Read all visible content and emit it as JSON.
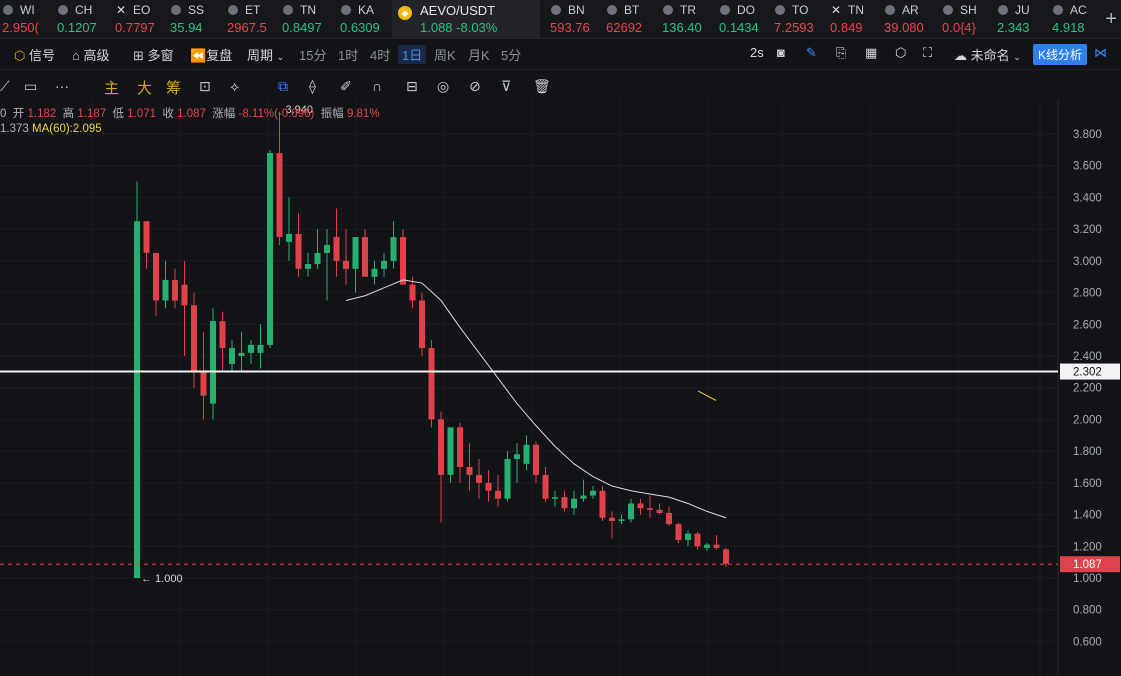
{
  "tickers": [
    {
      "icon": "coin-icon",
      "sym": "WI",
      "price": "2.950(",
      "dir": "dn",
      "left": 0
    },
    {
      "icon": "coin-icon",
      "sym": "CH",
      "price": "0.1207",
      "dir": "up",
      "left": 55
    },
    {
      "icon": "x-icon",
      "sym": "EO",
      "price": "0.7797",
      "dir": "dn",
      "left": 113
    },
    {
      "icon": "coin-icon",
      "sym": "SS",
      "price": "35.94",
      "dir": "up",
      "left": 168
    },
    {
      "icon": "coin-icon",
      "sym": "ET",
      "price": "2967.5",
      "dir": "dn",
      "left": 225
    },
    {
      "icon": "coin-icon",
      "sym": "TN",
      "price": "0.8497",
      "dir": "up",
      "left": 280
    },
    {
      "icon": "coin-icon",
      "sym": "KA",
      "price": "0.6309",
      "dir": "up",
      "left": 338
    },
    {
      "icon": "binance-icon",
      "sym": "AEVO/USDT",
      "price": "1.088  -8.03%",
      "dir": "up",
      "left": 392,
      "selected": true
    },
    {
      "icon": "coin-icon",
      "sym": "BN",
      "price": "593.76",
      "dir": "dn",
      "left": 548
    },
    {
      "icon": "coin-icon",
      "sym": "BT",
      "price": "62692",
      "dir": "dn",
      "left": 604
    },
    {
      "icon": "coin-icon",
      "sym": "TR",
      "price": "136.40",
      "dir": "up",
      "left": 660
    },
    {
      "icon": "coin-icon",
      "sym": "DO",
      "price": "0.1434",
      "dir": "up",
      "left": 717
    },
    {
      "icon": "coin-icon",
      "sym": "TO",
      "price": "7.2593",
      "dir": "dn",
      "left": 772
    },
    {
      "icon": "x-icon",
      "sym": "TN",
      "price": "0.849",
      "dir": "dn",
      "left": 828
    },
    {
      "icon": "coin-icon",
      "sym": "AR",
      "price": "39.080",
      "dir": "dn",
      "left": 882
    },
    {
      "icon": "coin-icon",
      "sym": "SH",
      "price": "0.0{4}",
      "dir": "dn",
      "left": 940
    },
    {
      "icon": "coin-icon",
      "sym": "JU",
      "price": "2.343",
      "dir": "up",
      "left": 995
    },
    {
      "icon": "coin-icon",
      "sym": "AC",
      "price": "4.918",
      "dir": "up",
      "left": 1050
    }
  ],
  "toolbar": {
    "signal": "信号",
    "advanced": "高级",
    "multi_window": "多窗",
    "replay": "复盘",
    "period": "周期",
    "periods": [
      "15分",
      "1时",
      "4时",
      "1日",
      "周K",
      "月K",
      "5分"
    ],
    "active_period": "1日",
    "refresh": "2s",
    "layout_name": "未命名",
    "kline_button": "K线分析"
  },
  "drawing_toolbar": {
    "labels": [
      "主",
      "大",
      "筹"
    ]
  },
  "info": {
    "line1_parts": [
      {
        "k": "0  开 ",
        "v": "1.182"
      },
      {
        "k": "  高 ",
        "v": "1.187"
      },
      {
        "k": "  低 ",
        "v": "1.071"
      },
      {
        "k": "  收 ",
        "v": "1.087"
      },
      {
        "k": "  涨幅 ",
        "v": "-8.11%(-0.096)"
      },
      {
        "k": "  振幅 ",
        "v": "9.81%"
      }
    ],
    "line2_prefix": "1.373  ",
    "ma_label": "MA(60):2.095"
  },
  "chart_data": {
    "type": "candlestick",
    "symbol": "AEVO/USDT",
    "interval": "1日",
    "ylim": [
      0.5,
      4.0
    ],
    "y_ticks": [
      3.8,
      3.6,
      3.4,
      3.2,
      3.0,
      2.8,
      2.6,
      2.4,
      2.2,
      2.0,
      1.8,
      1.6,
      1.4,
      1.2,
      1.0,
      0.8,
      0.6
    ],
    "y_tick_labels": [
      "3.800",
      "3.600",
      "3.400",
      "3.200",
      "3.000",
      "2.800",
      "2.600",
      "2.400",
      "2.200",
      "2.000",
      "1.800",
      "1.600",
      "1.400",
      "1.200",
      "1.000",
      "0.800",
      "0.600"
    ],
    "horizontal_line": {
      "price": 2.302,
      "label": "2.302"
    },
    "last_price": {
      "price": 1.087,
      "label": "1.087"
    },
    "high_marker": "3.940",
    "low_marker": "← 1.000",
    "candles": [
      {
        "o": 1.0,
        "h": 3.5,
        "l": 1.0,
        "c": 3.25
      },
      {
        "o": 3.25,
        "h": 3.25,
        "l": 2.95,
        "c": 3.05
      },
      {
        "o": 3.05,
        "h": 3.05,
        "l": 2.65,
        "c": 2.75
      },
      {
        "o": 2.75,
        "h": 3.0,
        "l": 2.7,
        "c": 2.88
      },
      {
        "o": 2.88,
        "h": 2.95,
        "l": 2.7,
        "c": 2.75
      },
      {
        "o": 2.85,
        "h": 3.0,
        "l": 2.4,
        "c": 2.72
      },
      {
        "o": 2.72,
        "h": 2.8,
        "l": 2.2,
        "c": 2.3
      },
      {
        "o": 2.3,
        "h": 2.55,
        "l": 2.0,
        "c": 2.15
      },
      {
        "o": 2.1,
        "h": 2.7,
        "l": 2.0,
        "c": 2.62
      },
      {
        "o": 2.62,
        "h": 2.68,
        "l": 2.3,
        "c": 2.45
      },
      {
        "o": 2.35,
        "h": 2.5,
        "l": 2.3,
        "c": 2.45
      },
      {
        "o": 2.4,
        "h": 2.55,
        "l": 2.3,
        "c": 2.42
      },
      {
        "o": 2.42,
        "h": 2.5,
        "l": 2.35,
        "c": 2.47
      },
      {
        "o": 2.42,
        "h": 2.6,
        "l": 2.32,
        "c": 2.47
      },
      {
        "o": 2.47,
        "h": 3.7,
        "l": 2.45,
        "c": 3.68
      },
      {
        "o": 3.68,
        "h": 3.94,
        "l": 3.1,
        "c": 3.15
      },
      {
        "o": 3.12,
        "h": 3.4,
        "l": 3.0,
        "c": 3.17
      },
      {
        "o": 3.17,
        "h": 3.3,
        "l": 2.9,
        "c": 2.95
      },
      {
        "o": 2.95,
        "h": 3.05,
        "l": 2.9,
        "c": 2.98
      },
      {
        "o": 2.98,
        "h": 3.2,
        "l": 2.95,
        "c": 3.05
      },
      {
        "o": 3.05,
        "h": 3.2,
        "l": 2.75,
        "c": 3.1
      },
      {
        "o": 3.15,
        "h": 3.33,
        "l": 2.9,
        "c": 3.0
      },
      {
        "o": 3.0,
        "h": 3.2,
        "l": 2.85,
        "c": 2.95
      },
      {
        "o": 2.95,
        "h": 3.1,
        "l": 2.8,
        "c": 3.15
      },
      {
        "o": 3.15,
        "h": 3.2,
        "l": 2.9,
        "c": 2.9
      },
      {
        "o": 2.9,
        "h": 3.0,
        "l": 2.85,
        "c": 2.95
      },
      {
        "o": 2.95,
        "h": 3.05,
        "l": 2.9,
        "c": 3.0
      },
      {
        "o": 3.0,
        "h": 3.25,
        "l": 2.95,
        "c": 3.15
      },
      {
        "o": 3.15,
        "h": 3.2,
        "l": 2.85,
        "c": 2.85
      },
      {
        "o": 2.85,
        "h": 2.9,
        "l": 2.7,
        "c": 2.75
      },
      {
        "o": 2.75,
        "h": 2.8,
        "l": 2.4,
        "c": 2.45
      },
      {
        "o": 2.45,
        "h": 2.5,
        "l": 1.95,
        "c": 2.0
      },
      {
        "o": 2.0,
        "h": 2.05,
        "l": 1.35,
        "c": 1.65
      },
      {
        "o": 1.65,
        "h": 1.95,
        "l": 1.6,
        "c": 1.95
      },
      {
        "o": 1.95,
        "h": 1.98,
        "l": 1.6,
        "c": 1.7
      },
      {
        "o": 1.7,
        "h": 1.85,
        "l": 1.55,
        "c": 1.65
      },
      {
        "o": 1.65,
        "h": 1.75,
        "l": 1.5,
        "c": 1.6
      },
      {
        "o": 1.6,
        "h": 1.68,
        "l": 1.48,
        "c": 1.55
      },
      {
        "o": 1.55,
        "h": 1.65,
        "l": 1.45,
        "c": 1.5
      },
      {
        "o": 1.5,
        "h": 1.8,
        "l": 1.48,
        "c": 1.75
      },
      {
        "o": 1.75,
        "h": 1.85,
        "l": 1.6,
        "c": 1.78
      },
      {
        "o": 1.72,
        "h": 1.9,
        "l": 1.68,
        "c": 1.84
      },
      {
        "o": 1.84,
        "h": 1.86,
        "l": 1.6,
        "c": 1.65
      },
      {
        "o": 1.65,
        "h": 1.7,
        "l": 1.48,
        "c": 1.5
      },
      {
        "o": 1.5,
        "h": 1.55,
        "l": 1.45,
        "c": 1.51
      },
      {
        "o": 1.51,
        "h": 1.55,
        "l": 1.42,
        "c": 1.44
      },
      {
        "o": 1.44,
        "h": 1.55,
        "l": 1.4,
        "c": 1.5
      },
      {
        "o": 1.5,
        "h": 1.62,
        "l": 1.48,
        "c": 1.52
      },
      {
        "o": 1.52,
        "h": 1.58,
        "l": 1.5,
        "c": 1.55
      },
      {
        "o": 1.55,
        "h": 1.58,
        "l": 1.36,
        "c": 1.38
      },
      {
        "o": 1.38,
        "h": 1.42,
        "l": 1.25,
        "c": 1.36
      },
      {
        "o": 1.36,
        "h": 1.4,
        "l": 1.34,
        "c": 1.37
      },
      {
        "o": 1.37,
        "h": 1.5,
        "l": 1.35,
        "c": 1.47
      },
      {
        "o": 1.47,
        "h": 1.5,
        "l": 1.4,
        "c": 1.44
      },
      {
        "o": 1.44,
        "h": 1.52,
        "l": 1.38,
        "c": 1.43
      },
      {
        "o": 1.43,
        "h": 1.47,
        "l": 1.4,
        "c": 1.41
      },
      {
        "o": 1.41,
        "h": 1.45,
        "l": 1.33,
        "c": 1.34
      },
      {
        "o": 1.34,
        "h": 1.35,
        "l": 1.22,
        "c": 1.24
      },
      {
        "o": 1.24,
        "h": 1.3,
        "l": 1.2,
        "c": 1.28
      },
      {
        "o": 1.28,
        "h": 1.29,
        "l": 1.18,
        "c": 1.2
      },
      {
        "o": 1.19,
        "h": 1.22,
        "l": 1.17,
        "c": 1.21
      },
      {
        "o": 1.21,
        "h": 1.27,
        "l": 1.18,
        "c": 1.19
      },
      {
        "o": 1.18,
        "h": 1.19,
        "l": 1.07,
        "c": 1.09
      }
    ],
    "ma_series": [
      {
        "i": 22,
        "v": 2.75
      },
      {
        "i": 24,
        "v": 2.78
      },
      {
        "i": 26,
        "v": 2.83
      },
      {
        "i": 28,
        "v": 2.88
      },
      {
        "i": 30,
        "v": 2.86
      },
      {
        "i": 32,
        "v": 2.75
      },
      {
        "i": 34,
        "v": 2.58
      },
      {
        "i": 36,
        "v": 2.42
      },
      {
        "i": 38,
        "v": 2.26
      },
      {
        "i": 40,
        "v": 2.1
      },
      {
        "i": 42,
        "v": 1.96
      },
      {
        "i": 44,
        "v": 1.83
      },
      {
        "i": 46,
        "v": 1.72
      },
      {
        "i": 48,
        "v": 1.64
      },
      {
        "i": 50,
        "v": 1.58
      },
      {
        "i": 52,
        "v": 1.55
      },
      {
        "i": 54,
        "v": 1.53
      },
      {
        "i": 56,
        "v": 1.51
      },
      {
        "i": 58,
        "v": 1.47
      },
      {
        "i": 60,
        "v": 1.42
      },
      {
        "i": 62,
        "v": 1.38
      }
    ]
  }
}
